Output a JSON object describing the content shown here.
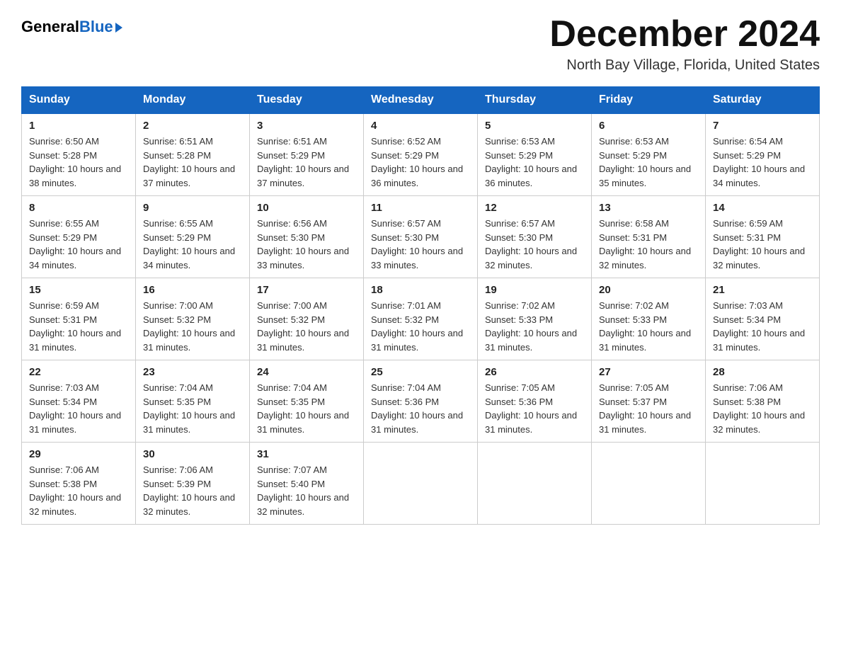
{
  "header": {
    "logo": {
      "general": "General",
      "blue": "Blue"
    },
    "month": "December 2024",
    "location": "North Bay Village, Florida, United States"
  },
  "weekdays": [
    "Sunday",
    "Monday",
    "Tuesday",
    "Wednesday",
    "Thursday",
    "Friday",
    "Saturday"
  ],
  "weeks": [
    [
      {
        "day": "1",
        "sunrise": "Sunrise: 6:50 AM",
        "sunset": "Sunset: 5:28 PM",
        "daylight": "Daylight: 10 hours and 38 minutes."
      },
      {
        "day": "2",
        "sunrise": "Sunrise: 6:51 AM",
        "sunset": "Sunset: 5:28 PM",
        "daylight": "Daylight: 10 hours and 37 minutes."
      },
      {
        "day": "3",
        "sunrise": "Sunrise: 6:51 AM",
        "sunset": "Sunset: 5:29 PM",
        "daylight": "Daylight: 10 hours and 37 minutes."
      },
      {
        "day": "4",
        "sunrise": "Sunrise: 6:52 AM",
        "sunset": "Sunset: 5:29 PM",
        "daylight": "Daylight: 10 hours and 36 minutes."
      },
      {
        "day": "5",
        "sunrise": "Sunrise: 6:53 AM",
        "sunset": "Sunset: 5:29 PM",
        "daylight": "Daylight: 10 hours and 36 minutes."
      },
      {
        "day": "6",
        "sunrise": "Sunrise: 6:53 AM",
        "sunset": "Sunset: 5:29 PM",
        "daylight": "Daylight: 10 hours and 35 minutes."
      },
      {
        "day": "7",
        "sunrise": "Sunrise: 6:54 AM",
        "sunset": "Sunset: 5:29 PM",
        "daylight": "Daylight: 10 hours and 34 minutes."
      }
    ],
    [
      {
        "day": "8",
        "sunrise": "Sunrise: 6:55 AM",
        "sunset": "Sunset: 5:29 PM",
        "daylight": "Daylight: 10 hours and 34 minutes."
      },
      {
        "day": "9",
        "sunrise": "Sunrise: 6:55 AM",
        "sunset": "Sunset: 5:29 PM",
        "daylight": "Daylight: 10 hours and 34 minutes."
      },
      {
        "day": "10",
        "sunrise": "Sunrise: 6:56 AM",
        "sunset": "Sunset: 5:30 PM",
        "daylight": "Daylight: 10 hours and 33 minutes."
      },
      {
        "day": "11",
        "sunrise": "Sunrise: 6:57 AM",
        "sunset": "Sunset: 5:30 PM",
        "daylight": "Daylight: 10 hours and 33 minutes."
      },
      {
        "day": "12",
        "sunrise": "Sunrise: 6:57 AM",
        "sunset": "Sunset: 5:30 PM",
        "daylight": "Daylight: 10 hours and 32 minutes."
      },
      {
        "day": "13",
        "sunrise": "Sunrise: 6:58 AM",
        "sunset": "Sunset: 5:31 PM",
        "daylight": "Daylight: 10 hours and 32 minutes."
      },
      {
        "day": "14",
        "sunrise": "Sunrise: 6:59 AM",
        "sunset": "Sunset: 5:31 PM",
        "daylight": "Daylight: 10 hours and 32 minutes."
      }
    ],
    [
      {
        "day": "15",
        "sunrise": "Sunrise: 6:59 AM",
        "sunset": "Sunset: 5:31 PM",
        "daylight": "Daylight: 10 hours and 31 minutes."
      },
      {
        "day": "16",
        "sunrise": "Sunrise: 7:00 AM",
        "sunset": "Sunset: 5:32 PM",
        "daylight": "Daylight: 10 hours and 31 minutes."
      },
      {
        "day": "17",
        "sunrise": "Sunrise: 7:00 AM",
        "sunset": "Sunset: 5:32 PM",
        "daylight": "Daylight: 10 hours and 31 minutes."
      },
      {
        "day": "18",
        "sunrise": "Sunrise: 7:01 AM",
        "sunset": "Sunset: 5:32 PM",
        "daylight": "Daylight: 10 hours and 31 minutes."
      },
      {
        "day": "19",
        "sunrise": "Sunrise: 7:02 AM",
        "sunset": "Sunset: 5:33 PM",
        "daylight": "Daylight: 10 hours and 31 minutes."
      },
      {
        "day": "20",
        "sunrise": "Sunrise: 7:02 AM",
        "sunset": "Sunset: 5:33 PM",
        "daylight": "Daylight: 10 hours and 31 minutes."
      },
      {
        "day": "21",
        "sunrise": "Sunrise: 7:03 AM",
        "sunset": "Sunset: 5:34 PM",
        "daylight": "Daylight: 10 hours and 31 minutes."
      }
    ],
    [
      {
        "day": "22",
        "sunrise": "Sunrise: 7:03 AM",
        "sunset": "Sunset: 5:34 PM",
        "daylight": "Daylight: 10 hours and 31 minutes."
      },
      {
        "day": "23",
        "sunrise": "Sunrise: 7:04 AM",
        "sunset": "Sunset: 5:35 PM",
        "daylight": "Daylight: 10 hours and 31 minutes."
      },
      {
        "day": "24",
        "sunrise": "Sunrise: 7:04 AM",
        "sunset": "Sunset: 5:35 PM",
        "daylight": "Daylight: 10 hours and 31 minutes."
      },
      {
        "day": "25",
        "sunrise": "Sunrise: 7:04 AM",
        "sunset": "Sunset: 5:36 PM",
        "daylight": "Daylight: 10 hours and 31 minutes."
      },
      {
        "day": "26",
        "sunrise": "Sunrise: 7:05 AM",
        "sunset": "Sunset: 5:36 PM",
        "daylight": "Daylight: 10 hours and 31 minutes."
      },
      {
        "day": "27",
        "sunrise": "Sunrise: 7:05 AM",
        "sunset": "Sunset: 5:37 PM",
        "daylight": "Daylight: 10 hours and 31 minutes."
      },
      {
        "day": "28",
        "sunrise": "Sunrise: 7:06 AM",
        "sunset": "Sunset: 5:38 PM",
        "daylight": "Daylight: 10 hours and 32 minutes."
      }
    ],
    [
      {
        "day": "29",
        "sunrise": "Sunrise: 7:06 AM",
        "sunset": "Sunset: 5:38 PM",
        "daylight": "Daylight: 10 hours and 32 minutes."
      },
      {
        "day": "30",
        "sunrise": "Sunrise: 7:06 AM",
        "sunset": "Sunset: 5:39 PM",
        "daylight": "Daylight: 10 hours and 32 minutes."
      },
      {
        "day": "31",
        "sunrise": "Sunrise: 7:07 AM",
        "sunset": "Sunset: 5:40 PM",
        "daylight": "Daylight: 10 hours and 32 minutes."
      },
      null,
      null,
      null,
      null
    ]
  ]
}
